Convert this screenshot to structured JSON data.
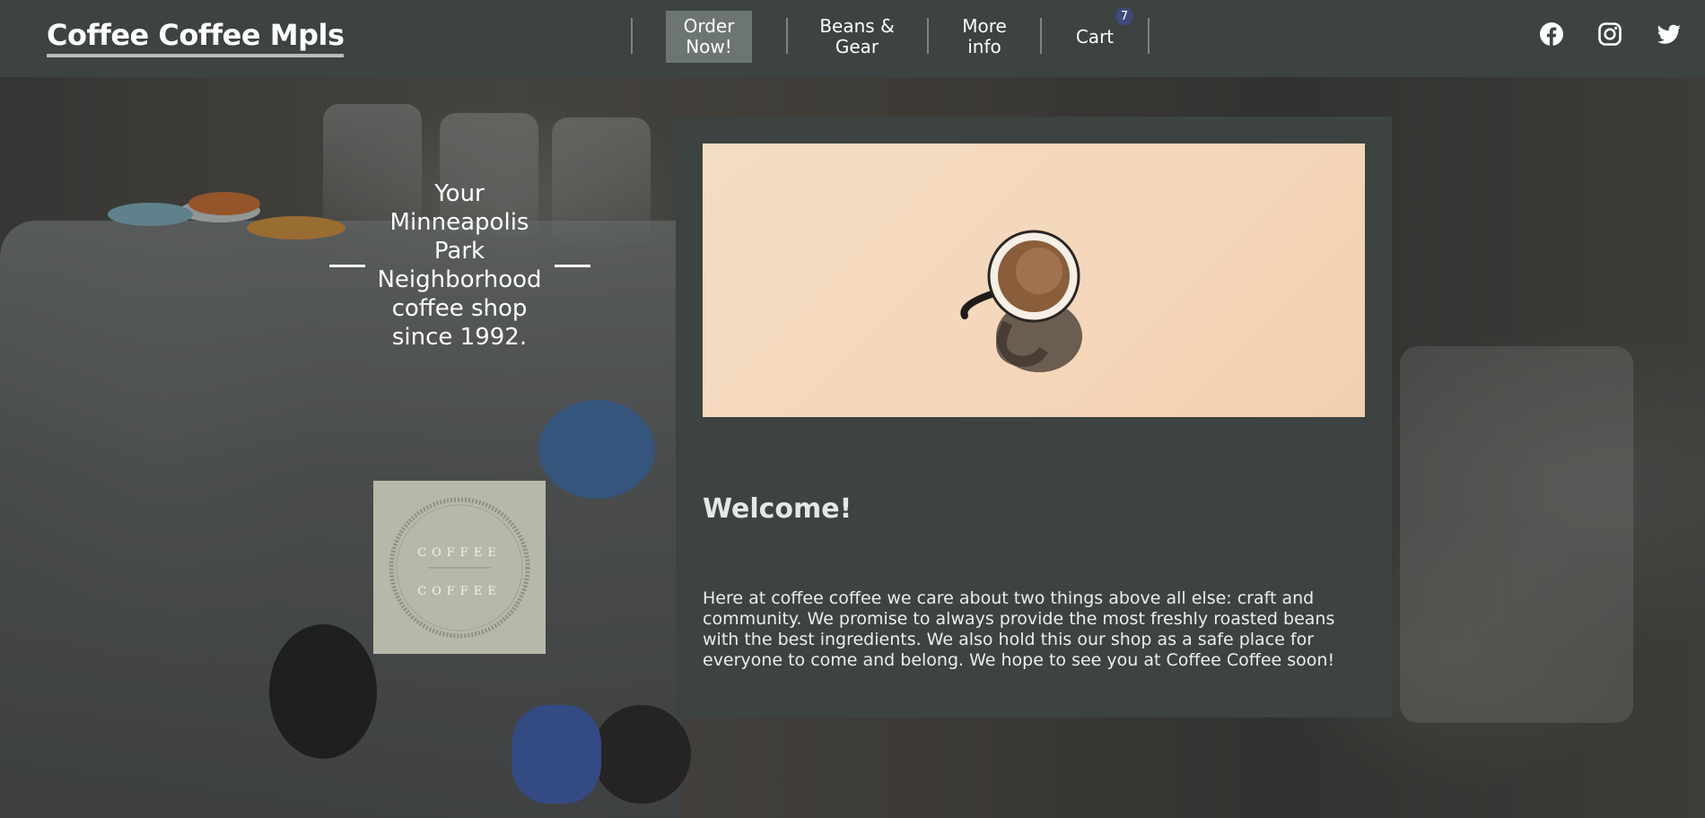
{
  "header": {
    "brand": "Coffee Coffee Mpls",
    "nav": {
      "order": "Order Now!",
      "beans": "Beans & Gear",
      "more": "More info",
      "cart": "Cart",
      "cart_count": "7"
    },
    "social": [
      "facebook-icon",
      "instagram-icon",
      "twitter-icon"
    ]
  },
  "hero": {
    "tagline": "Your Minneapolis Park Neighborhood coffee shop since 1992."
  },
  "logo": {
    "line1": "COFFEE",
    "line2": "COFFEE"
  },
  "panel": {
    "welcome": "Welcome!",
    "intro": "Here at coffee coffee we care about two things above all else: craft and community. We promise to always provide the most freshly roasted beans with the best ingredients. We also hold this our shop as a safe place for everyone to come and belong. We hope to see you at Coffee Coffee soon!"
  },
  "colors": {
    "header_bg": "#3c4340",
    "panel_bg": "#3c4340",
    "active_nav_bg": "#6d7572",
    "cart_badge": "#3e4a7a",
    "logo_bg": "#b7b9a8"
  }
}
